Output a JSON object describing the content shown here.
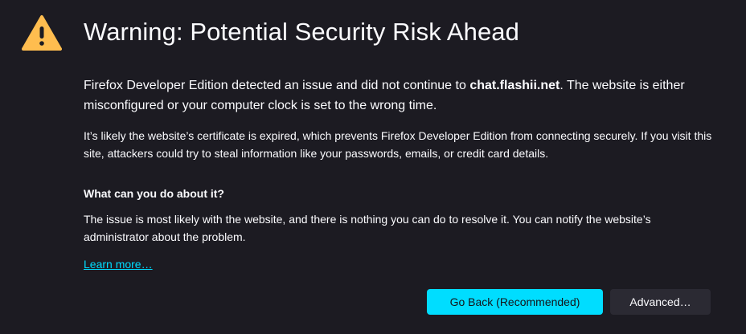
{
  "icons": {
    "warning": "warning-triangle-icon"
  },
  "colors": {
    "background": "#1c1b22",
    "text": "#fbfbfe",
    "accent": "#00ddff",
    "warning": "#ffbd4f",
    "secondary_button": "#2b2a33"
  },
  "page": {
    "title": "Warning: Potential Security Risk Ahead",
    "intro_before": "Firefox Developer Edition detected an issue and did not continue to ",
    "intro_host": "chat.flashii.net",
    "intro_after": ". The website is either misconfigured or your computer clock is set to the wrong time.",
    "detail": "It’s likely the website’s certificate is expired, which prevents Firefox Developer Edition from connecting securely. If you visit this site, attackers could try to steal information like your passwords, emails, or credit card details.",
    "question": "What can you do about it?",
    "answer": "The issue is most likely with the website, and there is nothing you can do to resolve it. You can notify the website’s administrator about the problem.",
    "learn_more": "Learn more…"
  },
  "buttons": {
    "go_back": "Go Back (Recommended)",
    "advanced": "Advanced…"
  }
}
